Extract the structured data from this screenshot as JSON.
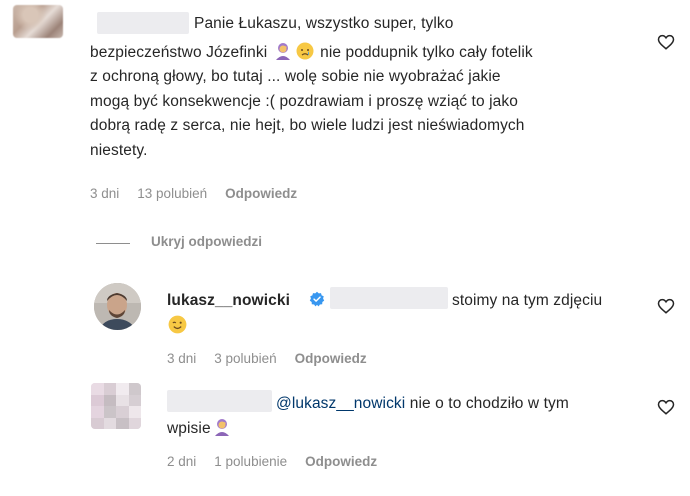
{
  "comment1": {
    "text_line1": "Panie Łukaszu, wszystko super, tylko",
    "text_line2a": "bezpieczeństwo Józefinki",
    "text_line2b": "nie poddupnik tylko cały fotelik",
    "text_line3": "z ochroną głowy, bo tutaj ... wolę sobie nie wyobrażać jakie",
    "text_line4": "mogą być konsekwencje :( pozdrawiam i proszę wziąć to jako",
    "text_line5": "dobrą radę z serca, nie hejt, bo wiele ludzi jest nieświadomych",
    "text_line6": "niestety.",
    "time": "3 dni",
    "likes": "13 polubień",
    "reply": "Odpowiedz",
    "emojis": [
      "person-facepalming-icon",
      "crying-face-icon"
    ]
  },
  "hide_replies": "Ukryj odpowiedzi",
  "reply1": {
    "username": "lukasz__nowicki",
    "verified": true,
    "text_line1": "stoimy na tym zdjęciu",
    "emoji": "winking-face-icon",
    "time": "3 dni",
    "likes": "3 polubień",
    "reply": "Odpowiedz"
  },
  "reply2": {
    "mention": "@lukasz__nowicki",
    "text_line1": "nie o to chodziło w tym",
    "text_line2": "wpisie",
    "emoji": "person-facepalming-icon",
    "time": "2 dni",
    "likes": "1 polubienie",
    "reply": "Odpowiedz"
  },
  "colors": {
    "text": "#262626",
    "meta": "#8e8e8e",
    "mention": "#00376b",
    "verified": "#3897f0"
  }
}
